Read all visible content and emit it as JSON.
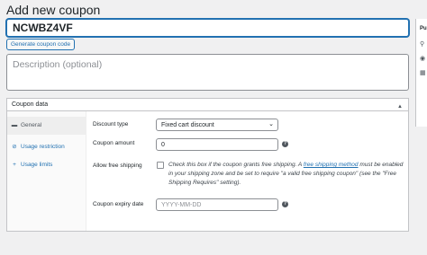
{
  "page": {
    "title": "Add new coupon"
  },
  "coupon": {
    "code": "NCWBZ4VF",
    "generate_label": "Generate coupon code",
    "description_placeholder": "Description (optional)"
  },
  "panel": {
    "title": "Coupon data",
    "tabs": [
      {
        "label": "General",
        "icon": "ticket-icon"
      },
      {
        "label": "Usage restriction",
        "icon": "block-icon"
      },
      {
        "label": "Usage limits",
        "icon": "plus-icon"
      }
    ],
    "general": {
      "discount_type_label": "Discount type",
      "discount_type_value": "Fixed cart discount",
      "coupon_amount_label": "Coupon amount",
      "coupon_amount_value": "0",
      "free_shipping_label": "Allow free shipping",
      "free_shipping_text_1": "Check this box if the coupon grants free shipping. A ",
      "free_shipping_link": "free shipping method",
      "free_shipping_text_2": " must be enabled in your shipping zone and be set to require \"a valid free shipping coupon\" (see the \"Free Shipping Requires\" setting).",
      "expiry_label": "Coupon expiry date",
      "expiry_placeholder": "YYYY-MM-DD"
    }
  },
  "sidebar": {
    "title_fragment": "Pu"
  }
}
